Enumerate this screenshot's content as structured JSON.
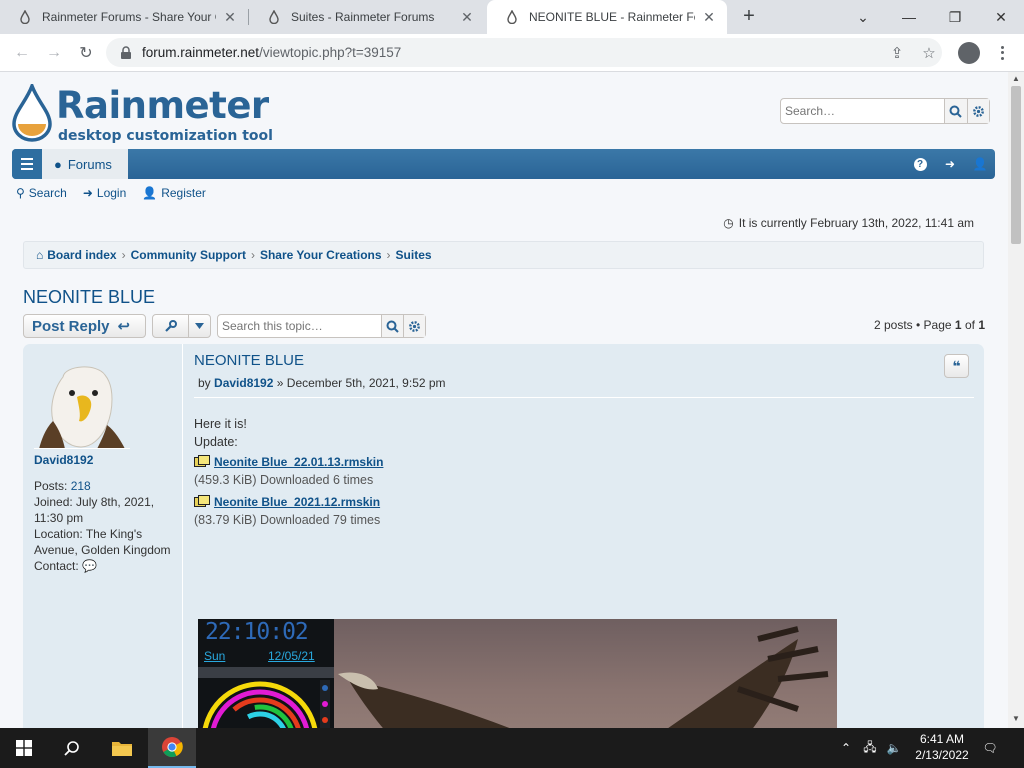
{
  "browser": {
    "tabs": [
      {
        "title": "Rainmeter Forums - Share Your Creations"
      },
      {
        "title": "Suites - Rainmeter Forums"
      },
      {
        "title": "NEONITE BLUE - Rainmeter Forums"
      }
    ],
    "url_host": "forum.rainmeter.net",
    "url_path": "/viewtopic.php?t=39157"
  },
  "site": {
    "brand": "Rainmeter",
    "tagline": "desktop customization tool",
    "search_placeholder": "Search…",
    "nav_forums": "Forums",
    "sublinks": {
      "search": "Search",
      "login": "Login",
      "register": "Register"
    },
    "current_time": "It is currently February 13th, 2022, 11:41 am",
    "breadcrumb": [
      "Board index",
      "Community Support",
      "Share Your Creations",
      "Suites"
    ]
  },
  "topic": {
    "title": "NEONITE BLUE",
    "post_reply": "Post Reply",
    "search_placeholder": "Search this topic…",
    "pagination": {
      "posts": "2 posts",
      "page_label": "Page",
      "page": "1",
      "of": "of",
      "total": "1"
    }
  },
  "post": {
    "title": "NEONITE BLUE",
    "by": "by",
    "author": "David8192",
    "date": "December 5th, 2021, 9:52 pm",
    "body_line1": "Here it is!",
    "body_line2": "Update:",
    "attachments": [
      {
        "name": "Neonite Blue_22.01.13.rmskin",
        "meta": "(459.3 KiB) Downloaded 6 times"
      },
      {
        "name": "Neonite Blue_2021.12.rmskin",
        "meta": "(83.79 KiB) Downloaded 79 times"
      }
    ],
    "skin_clock": "22:10:02",
    "skin_day": "Sun",
    "skin_date": "12/05/21"
  },
  "profile": {
    "username": "David8192",
    "posts_label": "Posts:",
    "posts": "218",
    "joined_label": "Joined:",
    "joined": "July 8th, 2021, 11:30 pm",
    "location_label": "Location:",
    "location": "The King's Avenue, Golden Kingdom",
    "contact_label": "Contact:"
  },
  "taskbar": {
    "time": "6:41 AM",
    "date": "2/13/2022"
  },
  "colors": {
    "link": "#105289",
    "navbar": "#2a6496",
    "post_bg": "#e1ebf2"
  }
}
